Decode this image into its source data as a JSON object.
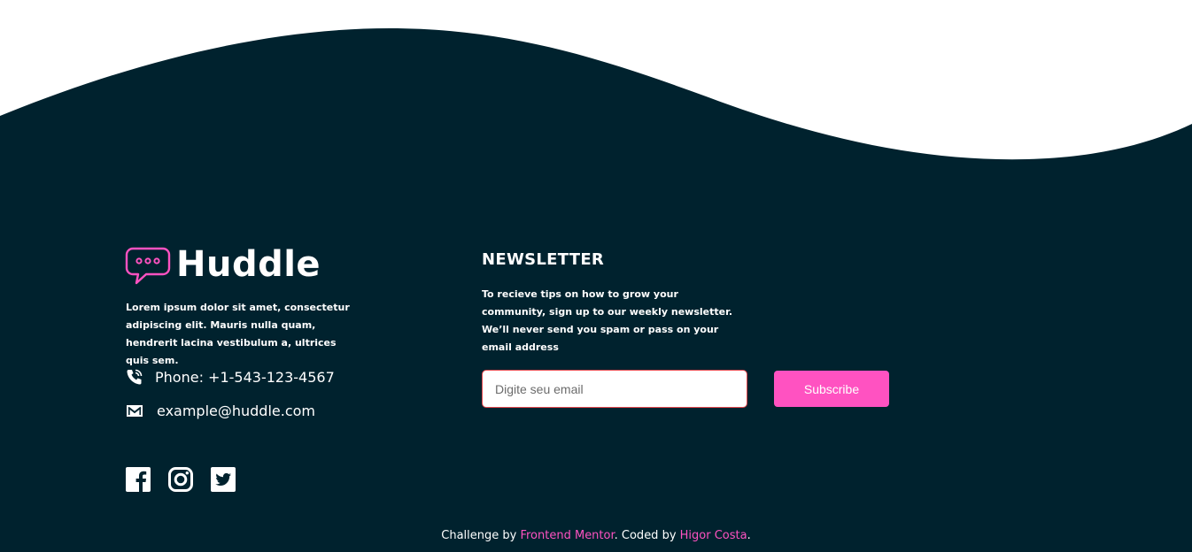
{
  "brand": {
    "name": "Huddle",
    "description": "Lorem ipsum dolor sit amet, consectetur adipiscing elit. Mauris nulla quam, hendrerit lacina vestibulum a, ultrices quis sem."
  },
  "contact": {
    "phone": "Phone: +1-543-123-4567",
    "email": "example@huddle.com"
  },
  "social": {
    "icons": [
      "facebook-icon",
      "instagram-icon",
      "twitter-icon"
    ]
  },
  "newsletter": {
    "title": "NEWSLETTER",
    "text": "To recieve tips on how to grow your community, sign up to our weekly newsletter. We’ll never send you spam or pass on your email address",
    "input_placeholder": "Digite seu email",
    "input_value": "",
    "button_label": "Subscribe"
  },
  "credits": {
    "prefix": "Challenge by ",
    "challenge_link": "Frontend Mentor",
    "middle": ". Coded by ",
    "author_link": "Higor Costa",
    "suffix": "."
  },
  "colors": {
    "background_dark": "#00222e",
    "accent_pink": "#ff52c1",
    "input_border": "#e5484d",
    "text_white": "#ffffff"
  }
}
